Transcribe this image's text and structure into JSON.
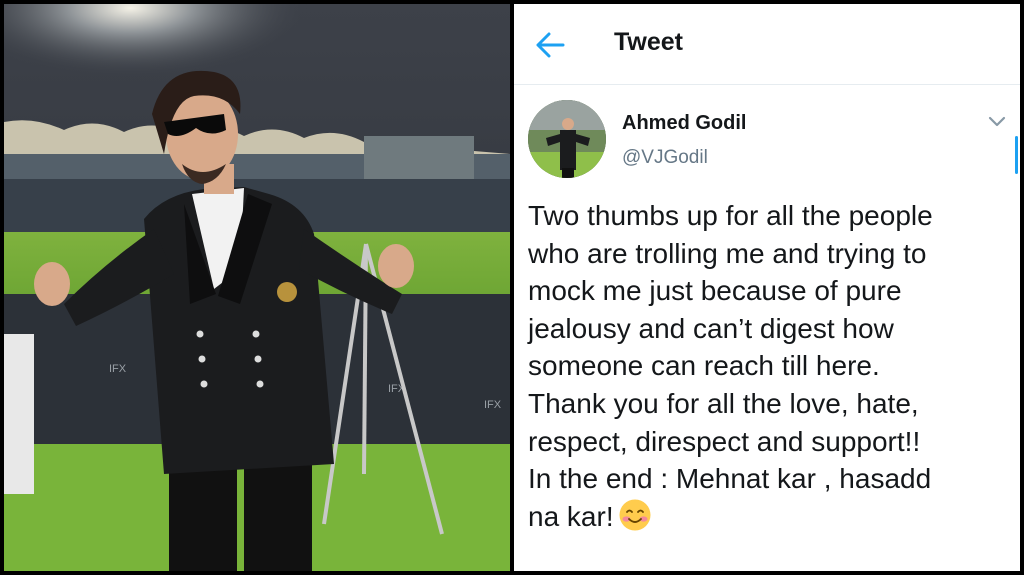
{
  "header": {
    "title": "Tweet",
    "back_icon": "arrow-left-icon"
  },
  "tweet": {
    "author_name": "Ahmed Godil",
    "author_handle": "@VJGodil",
    "menu_icon": "chevron-down-icon",
    "text": "Two thumbs up for all the people\nwho are trolling me and trying to\nmock me just because of pure\njealousy and can’t digest how\nsomeone can reach till here.\nThank you for all the love, hate,\nrespect, direspect and support!!\nIn the end : Mehnat kar , hasadd\nna kar!",
    "trailing_emoji": "smiling-blushing-face-icon"
  },
  "colors": {
    "accent": "#1da1f2",
    "text_primary": "#14171a",
    "text_secondary": "#657786",
    "divider": "#e6ecf0"
  }
}
